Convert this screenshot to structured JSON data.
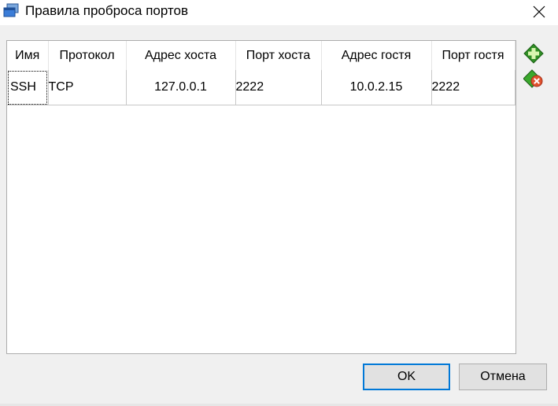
{
  "window": {
    "title": "Правила проброса портов"
  },
  "table": {
    "columns": [
      "Имя",
      "Протокол",
      "Адрес хоста",
      "Порт хоста",
      "Адрес гостя",
      "Порт гостя"
    ],
    "rows": [
      [
        "SSH",
        "TCP",
        "127.0.0.1",
        "2222",
        "10.0.2.15",
        "2222"
      ]
    ]
  },
  "side_buttons": {
    "add_icon": "add-rule-icon",
    "remove_icon": "remove-rule-icon"
  },
  "buttons": {
    "ok": "OK",
    "cancel": "Отмена"
  },
  "colors": {
    "accent": "#0078d7",
    "add_green": "#3aa82c",
    "remove_red": "#e0522e"
  }
}
